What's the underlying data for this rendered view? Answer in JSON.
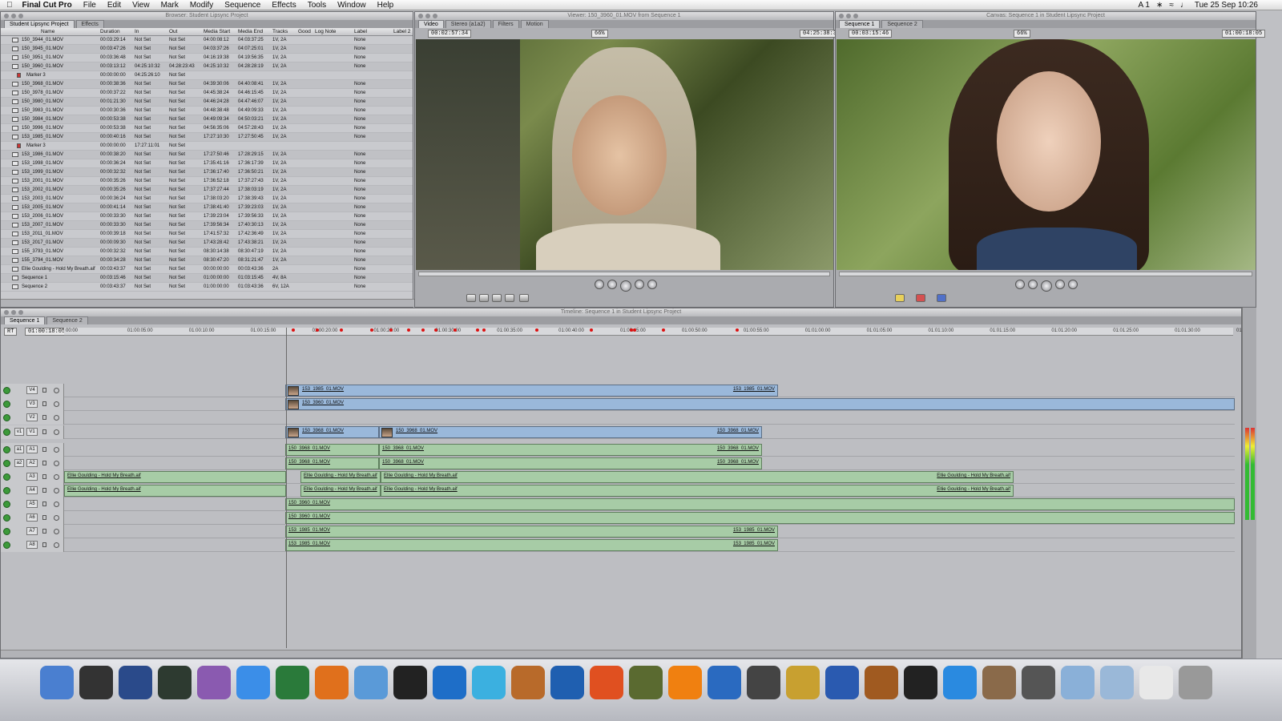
{
  "menubar": {
    "apple": "",
    "app_name": "Final Cut Pro",
    "items": [
      "File",
      "Edit",
      "View",
      "Mark",
      "Modify",
      "Sequence",
      "Effects",
      "Tools",
      "Window",
      "Help"
    ],
    "right_status": "A 1",
    "clock": "Tue 25 Sep  10:26"
  },
  "browser": {
    "title": "Browser: Student Lipsync Project",
    "tabs": [
      "Student Lipsync Project",
      "Effects"
    ],
    "columns": [
      "Name",
      "Duration",
      "In",
      "Out",
      "Media Start",
      "Media End",
      "Tracks",
      "Good",
      "Log Note",
      "Label",
      "Label 2"
    ],
    "rows": [
      [
        "150_3944_01.MOV",
        "00:03:29:14",
        "Not Set",
        "Not Set",
        "04:00:08:12",
        "04:03:37:25",
        "1V, 2A",
        "None"
      ],
      [
        "150_3945_01.MOV",
        "00:03:47:26",
        "Not Set",
        "Not Set",
        "04:03:37:26",
        "04:07:25:01",
        "1V, 2A",
        "None"
      ],
      [
        "150_3951_01.MOV",
        "00:03:36:48",
        "Not Set",
        "Not Set",
        "04:16:19:38",
        "04:19:56:35",
        "1V, 2A",
        "None"
      ],
      [
        "150_3960_01.MOV",
        "00:03:13:12",
        "04:25:10:32",
        "04:28:23:43",
        "04:25:10:32",
        "04:28:28:19",
        "1V, 2A",
        "None"
      ],
      [
        "Marker 3",
        "00:00:00:00",
        "04:25:26:10",
        "Not Set",
        "",
        "",
        "",
        ""
      ],
      [
        "150_3968_01.MOV",
        "00:00:38:36",
        "Not Set",
        "Not Set",
        "04:39:30:06",
        "04:40:08:41",
        "1V, 2A",
        "None"
      ],
      [
        "150_3978_01.MOV",
        "00:00:37:22",
        "Not Set",
        "Not Set",
        "04:45:38:24",
        "04:46:15:45",
        "1V, 2A",
        "None"
      ],
      [
        "150_3980_01.MOV",
        "00:01:21:30",
        "Not Set",
        "Not Set",
        "04:46:24:28",
        "04:47:46:07",
        "1V, 2A",
        "None"
      ],
      [
        "150_3983_01.MOV",
        "00:00:30:36",
        "Not Set",
        "Not Set",
        "04:48:38:48",
        "04:49:09:33",
        "1V, 2A",
        "None"
      ],
      [
        "150_3984_01.MOV",
        "00:00:53:38",
        "Not Set",
        "Not Set",
        "04:49:09:34",
        "04:50:03:21",
        "1V, 2A",
        "None"
      ],
      [
        "150_3996_01.MOV",
        "00:00:53:38",
        "Not Set",
        "Not Set",
        "04:56:35:06",
        "04:57:28:43",
        "1V, 2A",
        "None"
      ],
      [
        "153_1985_01.MOV",
        "00:00:40:16",
        "Not Set",
        "Not Set",
        "17:27:10:30",
        "17:27:50:45",
        "1V, 2A",
        "None"
      ],
      [
        "Marker 3",
        "00:00:00:00",
        "17:27:11:01",
        "Not Set",
        "",
        "",
        "",
        ""
      ],
      [
        "153_1986_01.MOV",
        "00:00:38:20",
        "Not Set",
        "Not Set",
        "17:27:50:46",
        "17:28:29:15",
        "1V, 2A",
        "None"
      ],
      [
        "153_1998_01.MOV",
        "00:00:36:24",
        "Not Set",
        "Not Set",
        "17:35:41:16",
        "17:36:17:39",
        "1V, 2A",
        "None"
      ],
      [
        "153_1999_01.MOV",
        "00:00:32:32",
        "Not Set",
        "Not Set",
        "17:36:17:40",
        "17:36:50:21",
        "1V, 2A",
        "None"
      ],
      [
        "153_2001_01.MOV",
        "00:00:35:26",
        "Not Set",
        "Not Set",
        "17:36:52:18",
        "17:37:27:43",
        "1V, 2A",
        "None"
      ],
      [
        "153_2002_01.MOV",
        "00:00:35:26",
        "Not Set",
        "Not Set",
        "17:37:27:44",
        "17:38:03:19",
        "1V, 2A",
        "None"
      ],
      [
        "153_2003_01.MOV",
        "00:00:36:24",
        "Not Set",
        "Not Set",
        "17:38:03:20",
        "17:38:39:43",
        "1V, 2A",
        "None"
      ],
      [
        "153_2005_01.MOV",
        "00:00:41:14",
        "Not Set",
        "Not Set",
        "17:38:41:40",
        "17:39:23:03",
        "1V, 2A",
        "None"
      ],
      [
        "153_2006_01.MOV",
        "00:00:33:30",
        "Not Set",
        "Not Set",
        "17:39:23:04",
        "17:39:56:33",
        "1V, 2A",
        "None"
      ],
      [
        "153_2007_01.MOV",
        "00:00:33:30",
        "Not Set",
        "Not Set",
        "17:39:56:34",
        "17:40:30:13",
        "1V, 2A",
        "None"
      ],
      [
        "153_2011_01.MOV",
        "00:00:39:18",
        "Not Set",
        "Not Set",
        "17:41:57:32",
        "17:42:36:49",
        "1V, 2A",
        "None"
      ],
      [
        "153_2017_01.MOV",
        "00:00:09:30",
        "Not Set",
        "Not Set",
        "17:43:28:42",
        "17:43:38:21",
        "1V, 2A",
        "None"
      ],
      [
        "155_3793_01.MOV",
        "00:00:32:32",
        "Not Set",
        "Not Set",
        "08:30:14:38",
        "08:30:47:19",
        "1V, 2A",
        "None"
      ],
      [
        "155_3794_01.MOV",
        "00:00:34:28",
        "Not Set",
        "Not Set",
        "08:30:47:20",
        "08:31:21:47",
        "1V, 2A",
        "None"
      ],
      [
        "Ellie Goulding - Hold My Breath.aif",
        "00:03:43:37",
        "Not Set",
        "Not Set",
        "00:00:00:00",
        "00:03:43:36",
        "2A",
        "None"
      ],
      [
        "Sequence 1",
        "00:03:15:46",
        "Not Set",
        "Not Set",
        "01:00:00:00",
        "01:03:15:45",
        "4V, 8A",
        "None"
      ],
      [
        "Sequence 2",
        "00:03:43:37",
        "Not Set",
        "Not Set",
        "01:00:00:00",
        "01:03:43:36",
        "6V, 12A",
        "None"
      ]
    ]
  },
  "viewer": {
    "title": "Viewer: 150_3960_01.MOV from Sequence 1",
    "tabs": [
      "Video",
      "Stereo (a1a2)",
      "Filters",
      "Motion"
    ],
    "timecode_left": "00:02:57:34",
    "timecode_right": "04:25:38:30",
    "zoom": "66%"
  },
  "canvas": {
    "title": "Canvas: Sequence 1 in Student Lipsync Project",
    "tabs": [
      "Sequence 1",
      "Sequence 2"
    ],
    "timecode_left": "00:03:15:46",
    "timecode_right": "01:00:18:05",
    "zoom": "66%"
  },
  "timeline": {
    "title": "Timeline: Sequence 1 in Student Lipsync Project",
    "tabs": [
      "Sequence 1",
      "Sequence 2"
    ],
    "rt": "RT",
    "current_tc": "01:00:18:05",
    "ruler": [
      "00:00",
      "01:00:05:00",
      "01:00:10:00",
      "01:00:15:00",
      "01:00:20:00",
      "01:00:25:00",
      "01:00:30:00",
      "01:00:35:00",
      "01:00:40:00",
      "01:00:45:00",
      "01:00:50:00",
      "01:00:55:00",
      "01:01:00:00",
      "01:01:05:00",
      "01:01:10:00",
      "01:01:15:00",
      "01:01:20:00",
      "01:01:25:00",
      "01:01:30:00",
      "01:01:3"
    ],
    "tracks": [
      {
        "label": "V4",
        "src": "",
        "clips": [
          {
            "name": "153_1985_01.MOV",
            "end_name": "153_1985_01.MOV",
            "kind": "v"
          }
        ]
      },
      {
        "label": "V3",
        "src": "",
        "clips": [
          {
            "name": "150_3960_01.MOV",
            "end_name": "",
            "kind": "v"
          }
        ]
      },
      {
        "label": "V2",
        "src": "",
        "clips": []
      },
      {
        "label": "V1",
        "src": "v1",
        "clips": [
          {
            "name": "150_3968_01.MOV",
            "end_name": "",
            "kind": "v"
          },
          {
            "name": "150_3968_01.MOV",
            "end_name": "150_3968_01.MOV",
            "kind": "v"
          }
        ]
      },
      {
        "label": "A1",
        "src": "a1",
        "clips": [
          {
            "name": "150_3968_01.MOV",
            "end_name": "",
            "kind": "a"
          },
          {
            "name": "150_3968_01.MOV",
            "end_name": "150_3968_01.MOV",
            "kind": "a"
          }
        ]
      },
      {
        "label": "A2",
        "src": "a2",
        "clips": [
          {
            "name": "150_3968_01.MOV",
            "end_name": "",
            "kind": "a"
          },
          {
            "name": "150_3968_01.MOV",
            "end_name": "150_3968_01.MOV",
            "kind": "a"
          }
        ]
      },
      {
        "label": "A3",
        "src": "",
        "clips": [
          {
            "name": "Ellie Goulding - Hold My Breath.aif",
            "end_name": "",
            "kind": "a"
          },
          {
            "name": "Ellie Goulding - Hold My Breath.aif",
            "end_name": "",
            "kind": "a"
          },
          {
            "name": "Ellie Goulding - Hold My Breath.aif",
            "end_name": "Ellie Goulding - Hold My Breath.aif",
            "kind": "a"
          }
        ]
      },
      {
        "label": "A4",
        "src": "",
        "clips": [
          {
            "name": "Ellie Goulding - Hold My Breath.aif",
            "end_name": "",
            "kind": "a"
          },
          {
            "name": "Ellie Goulding - Hold My Breath.aif",
            "end_name": "",
            "kind": "a"
          },
          {
            "name": "Ellie Goulding - Hold My Breath.aif",
            "end_name": "Ellie Goulding - Hold My Breath.aif",
            "kind": "a"
          }
        ]
      },
      {
        "label": "A5",
        "src": "",
        "clips": [
          {
            "name": "150_3960_01.MOV",
            "end_name": "",
            "kind": "a"
          }
        ]
      },
      {
        "label": "A6",
        "src": "",
        "clips": [
          {
            "name": "150_3960_01.MOV",
            "end_name": "",
            "kind": "a"
          }
        ]
      },
      {
        "label": "A7",
        "src": "",
        "clips": [
          {
            "name": "153_1985_01.MOV",
            "end_name": "153_1985_01.MOV",
            "kind": "a"
          }
        ]
      },
      {
        "label": "A8",
        "src": "",
        "clips": [
          {
            "name": "153_1985_01.MOV",
            "end_name": "153_1985_01.MOV",
            "kind": "a"
          }
        ]
      }
    ]
  },
  "dock": {
    "apps": [
      "Finder",
      "Final Cut Pro",
      "LiveType",
      "Soundtrack",
      "Motion",
      "Safari",
      "Network",
      "Firefox",
      "Kompozer",
      "X11",
      "Photoshop Elements",
      "Browser",
      "Stone",
      "Word",
      "PowerPoint",
      "Compressor",
      "VLC",
      "Sync",
      "iMovie",
      "Fruit",
      "iTunes",
      "GarageBand",
      "DVD",
      "QuickTime",
      "iPhoto",
      "System Preferences",
      "Applications",
      "Documents",
      "Downloads",
      "Trash"
    ]
  }
}
